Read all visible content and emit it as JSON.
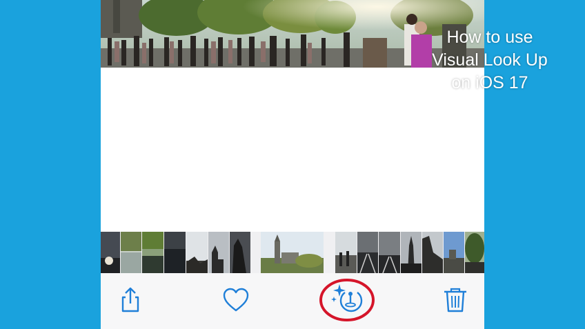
{
  "overlay": {
    "title_lines": [
      "How to use",
      "Visual Look Up",
      "on iOS 17"
    ]
  },
  "colors": {
    "background": "#1aa2dd",
    "ios_blue": "#1f7fd8",
    "highlight_circle": "#d5152a"
  },
  "main_photo": {
    "icon": "crowd-plaza-photo"
  },
  "filmstrip": {
    "thumbnails": [
      {
        "icon": "dusk-sky-thumbnail"
      },
      {
        "icon": "river-trees-thumbnail"
      },
      {
        "icon": "park-pond-thumbnail"
      },
      {
        "icon": "dark-water-thumbnail"
      },
      {
        "icon": "cloudy-sky-thumbnail"
      },
      {
        "icon": "cathedral-silhouette-thumbnail"
      },
      {
        "icon": "dark-cathedral-thumbnail"
      },
      {
        "icon": "basilica-selected-thumbnail"
      },
      {
        "icon": "street-people-thumbnail"
      },
      {
        "icon": "rail-tracks-thumbnail"
      },
      {
        "icon": "rails-dusk-thumbnail"
      },
      {
        "icon": "spire-sunset-thumbnail"
      },
      {
        "icon": "cliff-shadow-thumbnail"
      },
      {
        "icon": "blue-sky-building-thumbnail"
      },
      {
        "icon": "tree-edge-thumbnail"
      }
    ]
  },
  "toolbar": {
    "buttons": [
      {
        "name": "share",
        "icon": "share-icon"
      },
      {
        "name": "favorite",
        "icon": "heart-icon"
      },
      {
        "name": "visual-look-up",
        "icon": "visual-look-up-icon"
      },
      {
        "name": "delete",
        "icon": "trash-icon"
      }
    ]
  }
}
